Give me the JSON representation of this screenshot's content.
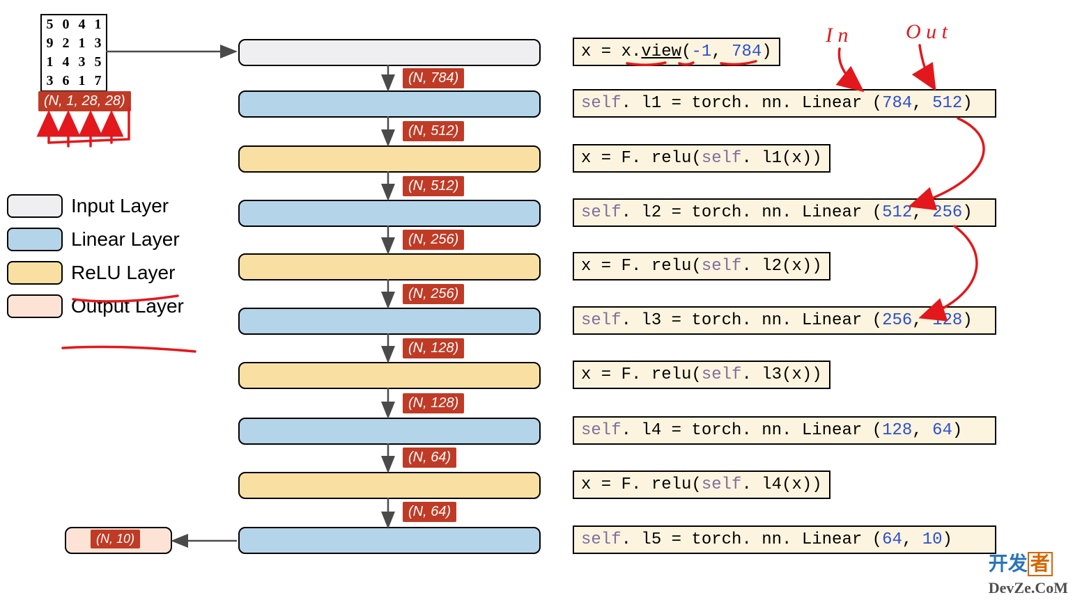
{
  "mnist_digits": [
    "5",
    "0",
    "4",
    "1",
    "9",
    "2",
    "1",
    "3",
    "1",
    "4",
    "3",
    "5",
    "3",
    "6",
    "1",
    "7"
  ],
  "input_shape_tag": "(N, 1, 28, 28)",
  "output_shape_tag": "(N, 10)",
  "flow_shapes": [
    "(N, 784)",
    "(N, 512)",
    "(N, 512)",
    "(N, 256)",
    "(N, 256)",
    "(N, 128)",
    "(N, 128)",
    "(N, 64)",
    "(N, 64)"
  ],
  "code_lines": {
    "view": {
      "pre": "x = x.",
      "fn": "view",
      "args_open": "(",
      "a": "-1",
      "sep": ",  ",
      "b": "784",
      "close": ")"
    },
    "l1": {
      "pre": "self",
      "mid": ". l1 = torch. nn. Linear (",
      "a": "784",
      "sep": ",  ",
      "b": "512",
      "close": ")"
    },
    "r1": {
      "open": "x = F. relu(",
      "self": "self",
      "mid": ". l1(x))"
    },
    "l2": {
      "pre": "self",
      "mid": ". l2 = torch. nn. Linear (",
      "a": "512",
      "sep": ",  ",
      "b": "256",
      "close": ")"
    },
    "r2": {
      "open": "x = F. relu(",
      "self": "self",
      "mid": ". l2(x))"
    },
    "l3": {
      "pre": "self",
      "mid": ". l3 = torch. nn. Linear (",
      "a": "256",
      "sep": ",  ",
      "b": "128",
      "close": ")"
    },
    "r3": {
      "open": "x = F. relu(",
      "self": "self",
      "mid": ". l3(x))"
    },
    "l4": {
      "pre": "self",
      "mid": ". l4 = torch. nn. Linear (",
      "a": "128",
      "sep": ",  ",
      "b": "64",
      "close": ")"
    },
    "r4": {
      "open": "x = F. relu(",
      "self": "self",
      "mid": ". l4(x))"
    },
    "l5": {
      "pre": "self",
      "mid": ". l5 = torch. nn. Linear (",
      "a": "64",
      "sep": ",  ",
      "b": "10",
      "close": ")"
    }
  },
  "annotations": {
    "in": "I n",
    "out": "O u t"
  },
  "legend": {
    "input": "Input Layer",
    "linear": "Linear Layer",
    "relu": "ReLU Layer",
    "output": "Output Layer"
  },
  "logo": {
    "p1": "开发",
    "p2": "者",
    "p3": "DevZe.CoM"
  }
}
